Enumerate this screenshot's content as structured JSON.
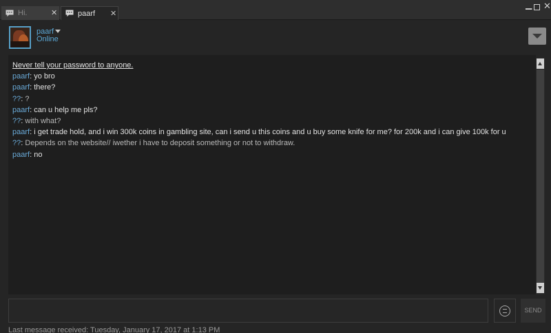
{
  "tabs": [
    {
      "label": "Hi.",
      "icon": "chat-bubble-icon",
      "close": "✕"
    },
    {
      "label": "paarf",
      "icon": "chat-bubble-icon",
      "close": "✕"
    }
  ],
  "window_controls": {
    "minimize": "▁",
    "close": "✕"
  },
  "friend": {
    "name": "paarf",
    "status": "Online"
  },
  "chat": {
    "warning": "Never tell your password to anyone.",
    "messages": [
      {
        "sender": "paarf",
        "text": "yo bro"
      },
      {
        "sender": "paarf",
        "text": "there?"
      },
      {
        "sender": "??",
        "text": "?"
      },
      {
        "sender": "paarf",
        "text": "can u help me pls?"
      },
      {
        "sender": "??",
        "text": "with what?"
      },
      {
        "sender": "paarf",
        "text": "i get trade hold, and i win 300k coins in gambling site, can i send u this coins and u buy some knife for me? for 200k and i can give 100k for u"
      },
      {
        "sender": "??",
        "text": "Depends on the website// iwether i have to deposit something or not to withdraw."
      },
      {
        "sender": "paarf",
        "text": "no"
      }
    ]
  },
  "composer": {
    "send_label": "SEND",
    "input_value": "",
    "emoticon_icon": "emoticon-icon"
  },
  "footer": {
    "last_received": "Last message received: Tuesday, January 17, 2017 at 1:13 PM"
  },
  "colors": {
    "accent": "#5ba8d6",
    "background": "#1e1e1e"
  }
}
